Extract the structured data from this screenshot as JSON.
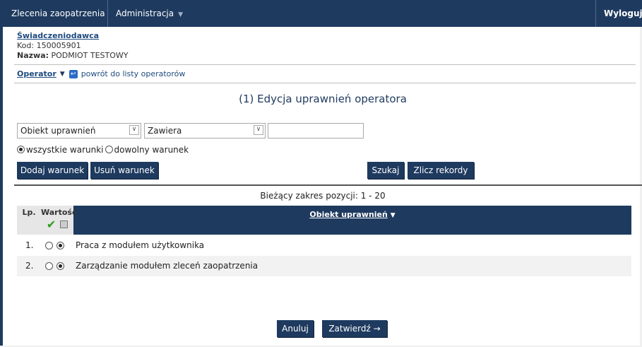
{
  "topbar": {
    "menu1": "Zlecenia zaopatrzenia",
    "menu2": "Administracja",
    "logout": "Wyloguj"
  },
  "provider": {
    "heading": "Świadczeniodawca",
    "kod_label": "Kod:",
    "kod_value": "150005901",
    "nazwa_label": "Nazwa:",
    "nazwa_value": "PODMIOT TESTOWY"
  },
  "operator": {
    "label": "Operator",
    "back_link": "powrót do listy operatorów"
  },
  "page_title": "(1) Edycja uprawnień operatora",
  "filter": {
    "field_select": "Obiekt uprawnień",
    "op_select": "Zawiera",
    "value": "",
    "radio_all": "wszystkie warunki",
    "radio_any": "dowolny warunek",
    "add_condition": "Dodaj warunek",
    "remove_condition": "Usuń warunek",
    "search": "Szukaj",
    "count": "Zlicz rekordy"
  },
  "range_text": "Bieżący zakres pozycji: 1 - 20",
  "table": {
    "col_lp": "Lp.",
    "col_value": "Wartość",
    "col_object": "Obiekt uprawnień",
    "rows": [
      {
        "lp": "1.",
        "label": "Praca z modułem użytkownika"
      },
      {
        "lp": "2.",
        "label": "Zarządzanie modułem zleceń zaopatrzenia"
      }
    ]
  },
  "footer": {
    "cancel": "Anuluj",
    "confirm": "Zatwierdź →"
  },
  "colors": {
    "nav": "#1e3a5f",
    "check": "#2e9a1e"
  }
}
